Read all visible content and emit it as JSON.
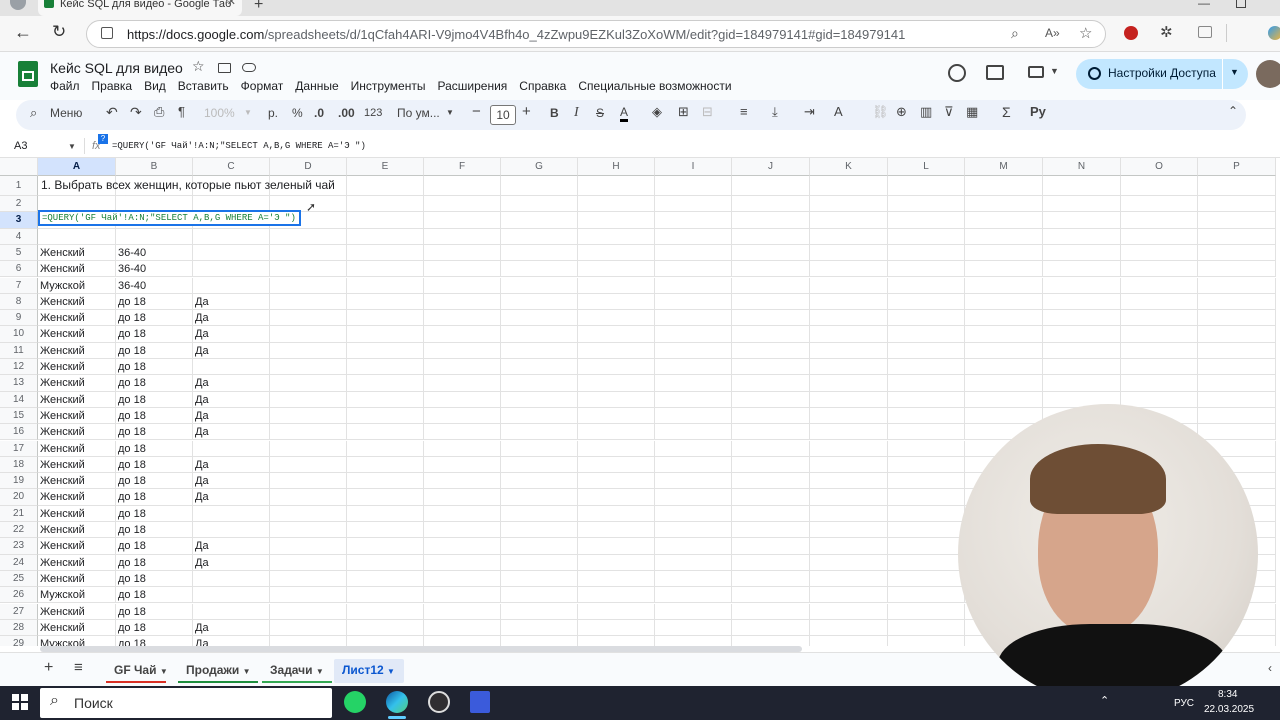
{
  "browser": {
    "tab_title": "Кейс SQL для видео - Google Таб",
    "url_host": "https://docs.google.com",
    "url_path": "/spreadsheets/d/1qCfah4ARI-V9jmo4V4Bfh4o_4zZwpu9EZKul3ZoXoWM/edit?gid=184979141#gid=184979141"
  },
  "doc": {
    "title": "Кейс SQL для видео",
    "menu": [
      "Файл",
      "Правка",
      "Вид",
      "Вставить",
      "Формат",
      "Данные",
      "Инструменты",
      "Расширения",
      "Справка",
      "Специальные возможности"
    ],
    "share_label": "Настройки Доступа"
  },
  "toolbar": {
    "menu_label": "Меню",
    "zoom": "100%",
    "currency": "р.",
    "percent": "%",
    "dec_less": ".0",
    "dec_more": ".00",
    "number_format": "123",
    "font": "По ум...",
    "font_size": "10"
  },
  "formula_bar": {
    "cell_ref": "A3",
    "formula": "=QUERY('GF Чай'!A:N;\"SELECT A,B,G WHERE A='Э \")"
  },
  "grid": {
    "columns": [
      "A",
      "B",
      "C",
      "D",
      "E",
      "F",
      "G",
      "H",
      "I",
      "J",
      "K",
      "L",
      "M",
      "N",
      "O",
      "P"
    ],
    "row1_text": "1. Выбрать всех женщин, которые пьют зеленый чай",
    "a3_formula": "=QUERY('GF Чай'!A:N;\"SELECT A,B,G WHERE A='Э \")",
    "rows": [
      {
        "n": "1",
        "a": "",
        "b": "",
        "c": ""
      },
      {
        "n": "2",
        "a": "",
        "b": "",
        "c": ""
      },
      {
        "n": "3",
        "a": "",
        "b": "",
        "c": ""
      },
      {
        "n": "4",
        "a": "",
        "b": "",
        "c": ""
      },
      {
        "n": "5",
        "a": "Женский",
        "b": "36-40",
        "c": ""
      },
      {
        "n": "6",
        "a": "Женский",
        "b": "36-40",
        "c": ""
      },
      {
        "n": "7",
        "a": "Мужской",
        "b": "36-40",
        "c": ""
      },
      {
        "n": "8",
        "a": "Женский",
        "b": "до 18",
        "c": "Да"
      },
      {
        "n": "9",
        "a": "Женский",
        "b": "до 18",
        "c": "Да"
      },
      {
        "n": "10",
        "a": "Женский",
        "b": "до 18",
        "c": "Да"
      },
      {
        "n": "11",
        "a": "Женский",
        "b": "до 18",
        "c": "Да"
      },
      {
        "n": "12",
        "a": "Женский",
        "b": "до 18",
        "c": ""
      },
      {
        "n": "13",
        "a": "Женский",
        "b": "до 18",
        "c": "Да"
      },
      {
        "n": "14",
        "a": "Женский",
        "b": "до 18",
        "c": "Да"
      },
      {
        "n": "15",
        "a": "Женский",
        "b": "до 18",
        "c": "Да"
      },
      {
        "n": "16",
        "a": "Женский",
        "b": "до 18",
        "c": "Да"
      },
      {
        "n": "17",
        "a": "Женский",
        "b": "до 18",
        "c": ""
      },
      {
        "n": "18",
        "a": "Женский",
        "b": "до 18",
        "c": "Да"
      },
      {
        "n": "19",
        "a": "Женский",
        "b": "до 18",
        "c": "Да"
      },
      {
        "n": "20",
        "a": "Женский",
        "b": "до 18",
        "c": "Да"
      },
      {
        "n": "21",
        "a": "Женский",
        "b": "до 18",
        "c": ""
      },
      {
        "n": "22",
        "a": "Женский",
        "b": "до 18",
        "c": ""
      },
      {
        "n": "23",
        "a": "Женский",
        "b": "до 18",
        "c": "Да"
      },
      {
        "n": "24",
        "a": "Женский",
        "b": "до 18",
        "c": "Да"
      },
      {
        "n": "25",
        "a": "Женский",
        "b": "до 18",
        "c": ""
      },
      {
        "n": "26",
        "a": "Мужской",
        "b": "до 18",
        "c": ""
      },
      {
        "n": "27",
        "a": "Женский",
        "b": "до 18",
        "c": ""
      },
      {
        "n": "28",
        "a": "Женский",
        "b": "до 18",
        "c": "Да"
      },
      {
        "n": "29",
        "a": "Мужской",
        "b": "до 18",
        "c": "Да"
      }
    ]
  },
  "sheets": [
    {
      "label": "GF Чай",
      "color": "#d93025"
    },
    {
      "label": "Продажи",
      "color": "#1e8e3e"
    },
    {
      "label": "Задачи",
      "color": "#34a853"
    },
    {
      "label": "Лист12",
      "color": "#1a73e8"
    }
  ],
  "taskbar": {
    "search_label": "Поиск",
    "lang": "РУС",
    "time": "8:34",
    "date": "22.03.2025"
  },
  "colors": {
    "accent": "#1a73e8",
    "share_bg": "#c2e7ff",
    "sheets_green": "#188038"
  }
}
